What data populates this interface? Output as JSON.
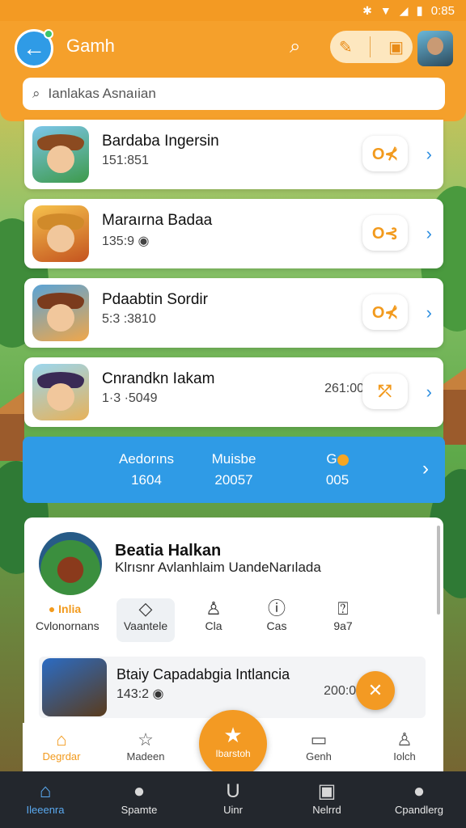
{
  "status_bar": {
    "time": "0:85"
  },
  "header": {
    "title": "Gamh",
    "search_placeholder": "Ianlakas Asnaıian"
  },
  "games": [
    {
      "title": "Bardaba Ingersin",
      "subtitle": "151:851",
      "extra": "",
      "action": "O⊀"
    },
    {
      "title": "Maraırna Badaa",
      "subtitle": "135:9 ◉",
      "extra": "",
      "action": "O⊰"
    },
    {
      "title": "Pdaabtin Sordir",
      "subtitle": "5:3 :3810",
      "extra": "",
      "action": "O⊀"
    },
    {
      "title": "Cnrandkn Iakam",
      "subtitle": "1·3 ·5049",
      "extra": "261:00",
      "action": "⤱"
    }
  ],
  "banner": {
    "stats": [
      {
        "label": "Aedorıns",
        "value": "1604"
      },
      {
        "label": "Muisbe",
        "value": "20057"
      },
      {
        "label": "G",
        "value": "005"
      }
    ]
  },
  "detail": {
    "title": "Beatia Halkan",
    "subtitle": "Klrısnr Avlanhlaim UandeNarılada",
    "tabs": [
      {
        "icon": "● Inlia",
        "label": "Cvlonornans"
      },
      {
        "icon": "◇",
        "label": "Vaantele"
      },
      {
        "icon": "♙",
        "label": "Cla"
      },
      {
        "icon": "ⓘ",
        "label": "Cas"
      },
      {
        "icon": "⍰",
        "label": "9a7"
      }
    ],
    "row": {
      "title": "Btaiy Capadabgia Intlancia",
      "subtitle": "143:2 ◉",
      "extra": "200:080"
    }
  },
  "app_nav": [
    {
      "label": "Degrdar",
      "icon": "⌂"
    },
    {
      "label": "Madeen",
      "icon": "☆"
    },
    {
      "label": "Ibarstoh",
      "icon": "★"
    },
    {
      "label": "Genh",
      "icon": "▭"
    },
    {
      "label": "Iolch",
      "icon": "♙"
    }
  ],
  "system_nav": [
    {
      "label": "Ileeenra",
      "icon": "⌂"
    },
    {
      "label": "Spamte",
      "icon": "●"
    },
    {
      "label": "Uinr",
      "icon": "U"
    },
    {
      "label": "Nelrrd",
      "icon": "▣"
    },
    {
      "label": "Cpandlerg",
      "icon": "●"
    }
  ],
  "colors": {
    "accent": "#f39a23",
    "blue": "#2f9be6",
    "nav_dark": "#23272d"
  }
}
